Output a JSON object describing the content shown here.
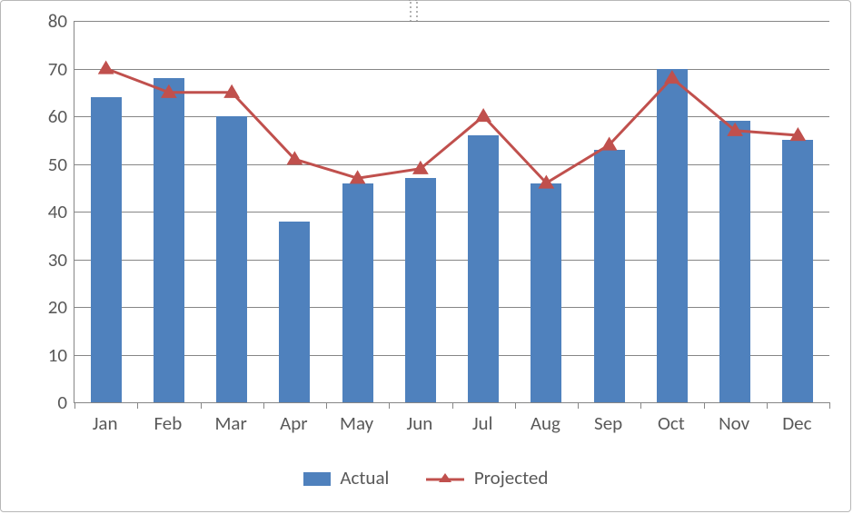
{
  "chart_data": {
    "type": "bar+line",
    "categories": [
      "Jan",
      "Feb",
      "Mar",
      "Apr",
      "May",
      "Jun",
      "Jul",
      "Aug",
      "Sep",
      "Oct",
      "Nov",
      "Dec"
    ],
    "series": [
      {
        "name": "Actual",
        "kind": "bar",
        "values": [
          64,
          68,
          60,
          38,
          46,
          47,
          56,
          46,
          53,
          70,
          59,
          55
        ]
      },
      {
        "name": "Projected",
        "kind": "line",
        "values": [
          70,
          65,
          65,
          51,
          47,
          49,
          60,
          46,
          54,
          68,
          57,
          56
        ]
      }
    ],
    "ylim": [
      0,
      80
    ],
    "yticks": [
      0,
      10,
      20,
      30,
      40,
      50,
      60,
      70,
      80
    ],
    "legend": {
      "actual": "Actual",
      "projected": "Projected"
    }
  }
}
